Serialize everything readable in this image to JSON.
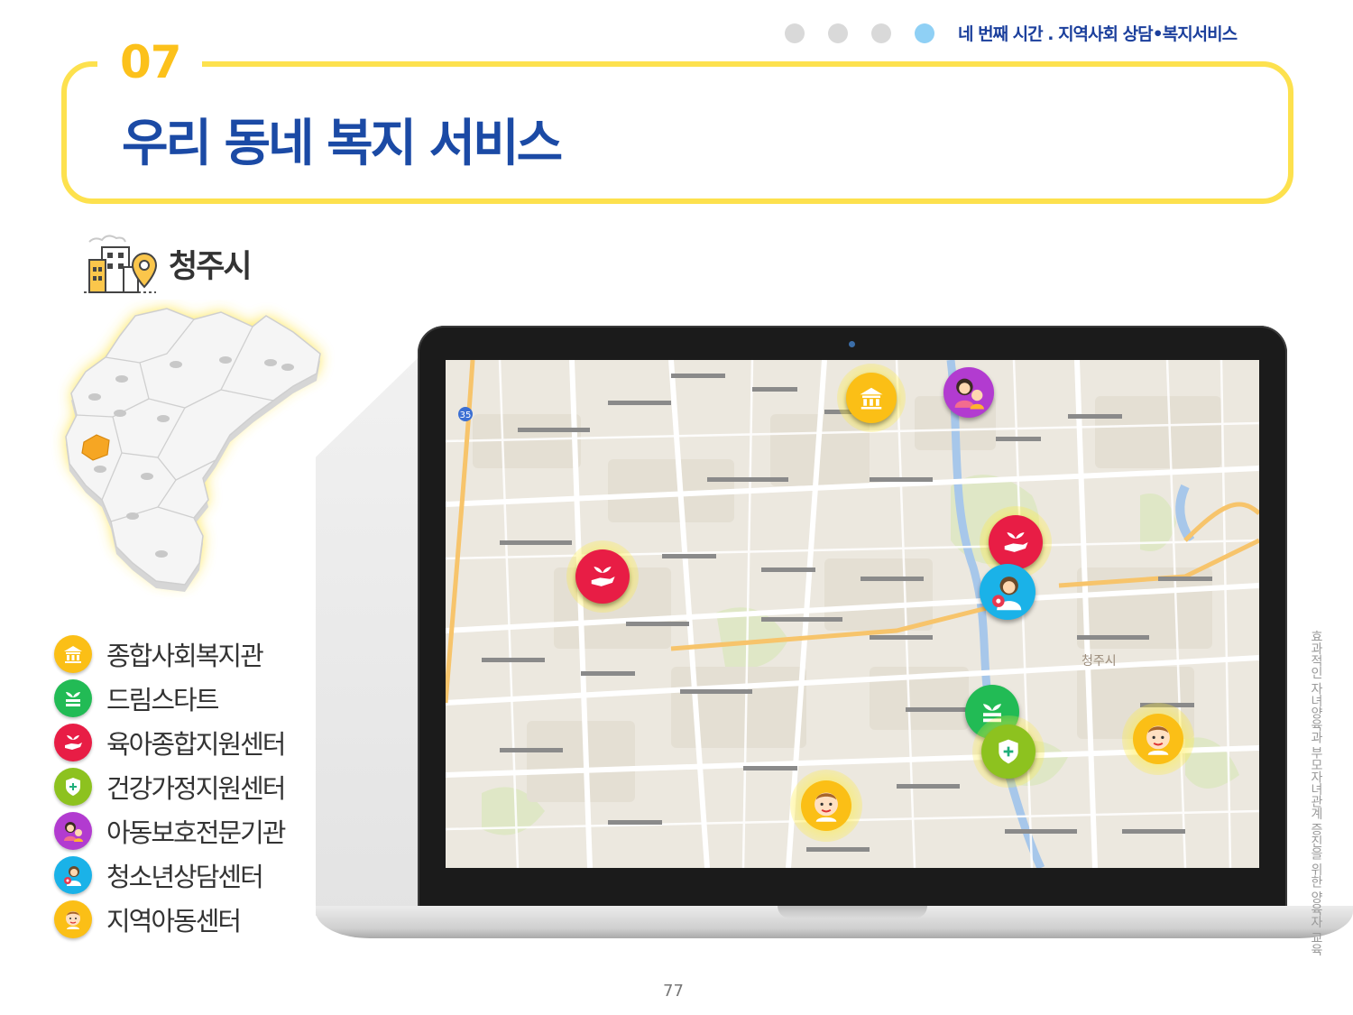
{
  "header": {
    "breadcrumb": "네 번째 시간 . 지역사회 상담•복지서비스",
    "nav_dots": 4,
    "active_dot_index": 4
  },
  "section": {
    "number": "07",
    "title": "우리 동네 복지 서비스"
  },
  "city": {
    "name": "청주시"
  },
  "legend": [
    {
      "label": "종합사회복지관",
      "icon": "building-icon",
      "color": "#fbbf16"
    },
    {
      "label": "드림스타트",
      "icon": "dream-start-icon",
      "color": "#22bb55"
    },
    {
      "label": "육아종합지원센터",
      "icon": "childcare-hand-icon",
      "color": "#e81d45"
    },
    {
      "label": "건강가정지원센터",
      "icon": "shield-cross-icon",
      "color": "#8dc21f"
    },
    {
      "label": "아동보호전문기관",
      "icon": "mother-child-icon",
      "color": "#b23bd0"
    },
    {
      "label": "청소년상담센터",
      "icon": "counselor-icon",
      "color": "#1ab2e8"
    },
    {
      "label": "지역아동센터",
      "icon": "child-face-icon",
      "color": "#fbbf16"
    }
  ],
  "map_labels": {
    "region": "청주시",
    "main_road": "35"
  },
  "side_text": "효과적인 자녀양육과 부모자녀관계 증진을 위한 양육자 교육",
  "page_number": "77",
  "colors": {
    "title_blue": "#1b4aa5",
    "frame_yellow": "#fde14e",
    "number_orange": "#fcc11b",
    "active_dot": "#8fd0f5"
  }
}
